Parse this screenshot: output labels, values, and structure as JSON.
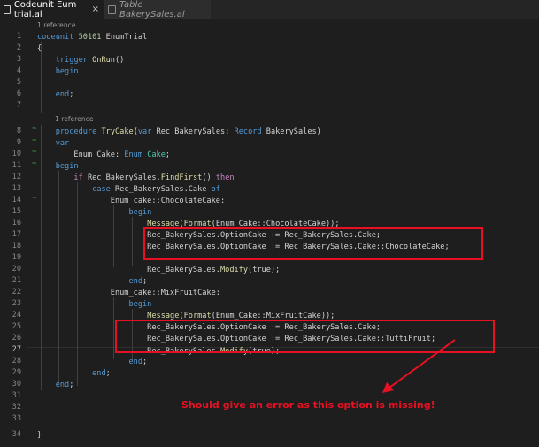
{
  "tabs": [
    {
      "label": "Codeunit Eum trial.al",
      "active": true,
      "close": "×"
    },
    {
      "label": "Table BakerySales.al",
      "active": false
    }
  ],
  "editor": {
    "line_numbers": [
      "1",
      "2",
      "3",
      "4",
      "5",
      "6",
      "7",
      "8",
      "9",
      "10",
      "11",
      "12",
      "13",
      "14",
      "15",
      "16",
      "17",
      "18",
      "19",
      "20",
      "21",
      "22",
      "23",
      "24",
      "25",
      "26",
      "27",
      "28",
      "29",
      "30",
      "31",
      "32",
      "33",
      "34"
    ],
    "references": [
      "1 reference",
      "1 reference"
    ],
    "lines": [
      "codeunit 50101 EnumTrial",
      "{",
      "    trigger OnRun()",
      "    begin",
      "",
      "    end;",
      "",
      "    procedure TryCake(var Rec_BakerySales: Record BakerySales)",
      "    var",
      "        Enum_Cake: Enum Cake;",
      "    begin",
      "        if Rec_BakerySales.FindFirst() then",
      "            case Rec_BakerySales.Cake of",
      "                Enum_cake::ChocolateCake:",
      "                    begin",
      "                        Message(Format(Enum_Cake::ChocolateCake));",
      "                        Rec_BakerySales.OptionCake := Rec_BakerySales.Cake;",
      "                        Rec_BakerySales.OptionCake := Rec_BakerySales.Cake::ChocolateCake;",
      "",
      "                        Rec_BakerySales.Modify(true);",
      "                    end;",
      "                Enum_cake::MixFruitCake:",
      "                    begin",
      "                        Message(Format(Enum_Cake::MixFruitCake));",
      "                        Rec_BakerySales.OptionCake := Rec_BakerySales.Cake;",
      "                        Rec_BakerySales.OptionCake := Rec_BakerySales.Cake::TuttiFruit;",
      "                        Rec_BakerySales.Modify(true);",
      "                    end;",
      "            end;",
      "    end;",
      "",
      "",
      "",
      "}"
    ]
  },
  "annotation": {
    "text": "Should give an error as this option is missing!",
    "color": "#e81123"
  },
  "colors": {
    "keyword": "#569cd6",
    "control": "#c586c0",
    "function": "#dcdcaa",
    "type": "#4ec9b0",
    "number": "#b5cea8",
    "text": "#d4d4d4"
  }
}
